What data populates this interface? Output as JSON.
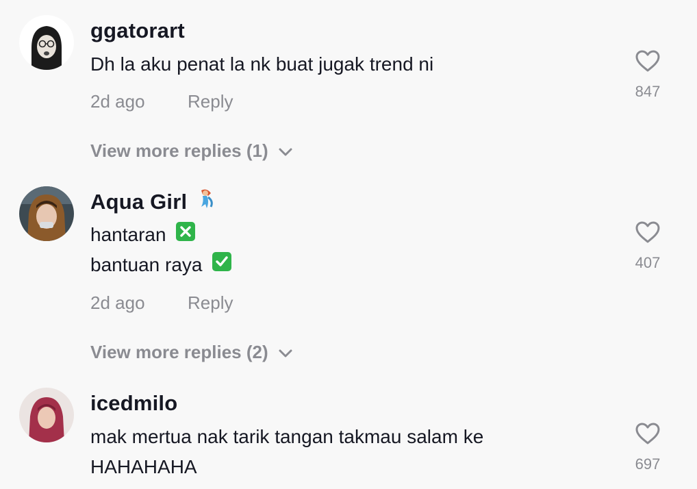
{
  "comments": [
    {
      "username": "ggatorart",
      "lines": [
        "Dh la aku penat la nk buat jugak trend ni"
      ],
      "time": "2d ago",
      "reply_label": "Reply",
      "likes": "847",
      "view_more": "View more replies (1)"
    },
    {
      "username": "Aqua Girl",
      "username_emoji": "mermaid-emoji",
      "lines": [
        "hantaran",
        "bantuan raya"
      ],
      "line_emojis": [
        "cross-mark-emoji",
        "check-mark-emoji"
      ],
      "time": "2d ago",
      "reply_label": "Reply",
      "likes": "407",
      "view_more": "View more replies (2)"
    },
    {
      "username": "icedmilo",
      "lines": [
        "mak mertua nak tarik tangan takmau salam ke",
        "HAHAHAHA"
      ],
      "likes": "697"
    }
  ],
  "icons": {
    "like": "heart-outline-icon",
    "expand": "chevron-down-icon"
  },
  "colors": {
    "background": "#f8f8f8",
    "primary_text": "#161823",
    "secondary_text": "#8a8b91",
    "emoji_green": "#2fb44a"
  }
}
